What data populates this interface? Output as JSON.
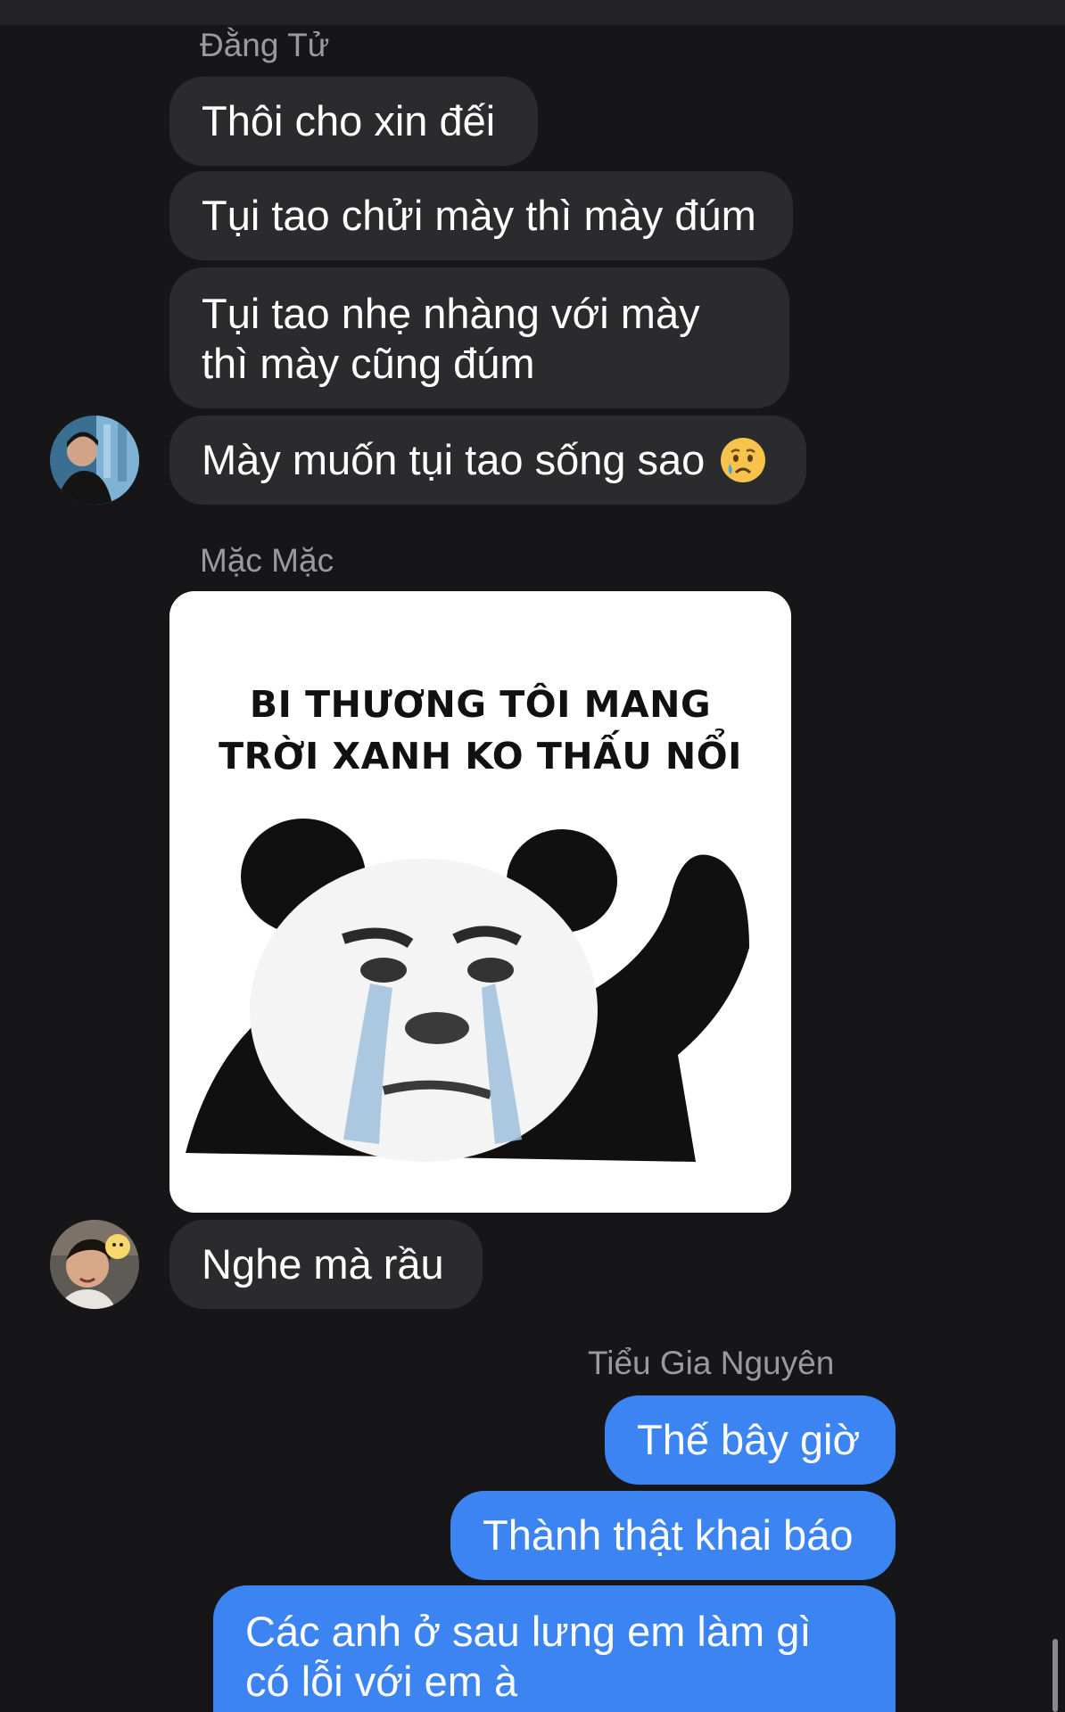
{
  "colors": {
    "background": "#161618",
    "incoming_bubble": "#2b2b2e",
    "outgoing_bubble": "#3b84f1",
    "sender_name": "#9a9a9e",
    "text": "#ffffff"
  },
  "groups": [
    {
      "sender": "Đằng Tử",
      "direction": "incoming",
      "messages": [
        "Thôi cho xin đếi",
        "Tụi tao chửi mày thì mày đúm",
        "Tụi tao nhẹ nhàng với mày thì mày cũng đúm",
        "Mày muốn tụi tao sống sao"
      ],
      "last_message_emoji": "crying-face"
    },
    {
      "sender": "Mặc Mặc",
      "direction": "incoming",
      "sticker": {
        "caption_line_1": "BI THƯƠNG TÔI MANG",
        "caption_line_2": "TRỜI XANH KO THẤU NỔI",
        "image": "crying-panda-meme"
      },
      "messages": [
        "Nghe mà rầu"
      ]
    },
    {
      "sender": "Tiểu Gia Nguyên",
      "direction": "outgoing",
      "messages": [
        "Thế bây giờ",
        "Thành thật khai báo",
        "Các anh ở sau lưng em làm gì có lỗi với em à"
      ]
    }
  ]
}
